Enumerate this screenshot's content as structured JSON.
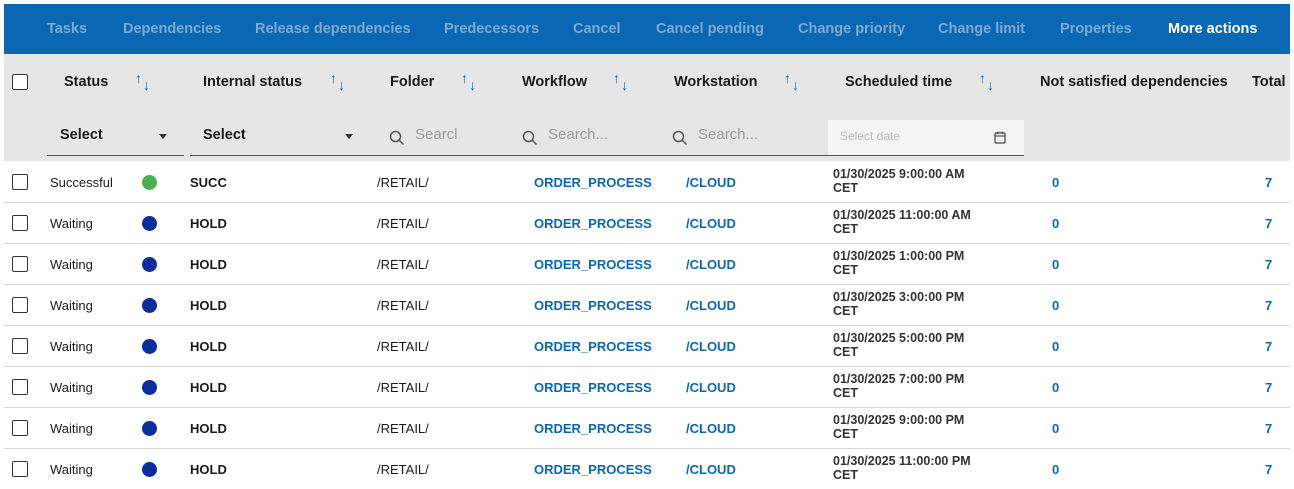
{
  "toolbar": {
    "items": [
      {
        "label": "Tasks",
        "active": false
      },
      {
        "label": "Dependencies",
        "active": false
      },
      {
        "label": "Release dependencies",
        "active": false
      },
      {
        "label": "Predecessors",
        "active": false
      },
      {
        "label": "Cancel",
        "active": false
      },
      {
        "label": "Cancel pending",
        "active": false
      },
      {
        "label": "Change priority",
        "active": false
      },
      {
        "label": "Change limit",
        "active": false
      },
      {
        "label": "Properties",
        "active": false
      },
      {
        "label": "More actions",
        "active": true
      }
    ]
  },
  "columns": {
    "status": "Status",
    "internal_status": "Internal status",
    "folder": "Folder",
    "workflow": "Workflow",
    "workstation": "Workstation",
    "scheduled_time": "Scheduled time",
    "not_satisfied": "Not satisfied dependencies",
    "total": "Total"
  },
  "filters": {
    "status_select": "Select",
    "internal_status_select": "Select",
    "folder_search": "Searcl",
    "workflow_search": "Search...",
    "workstation_search": "Search...",
    "date_placeholder": "Select date"
  },
  "colors": {
    "toolbar_bg": "#0a67b4",
    "success_dot": "#4caf50",
    "waiting_dot": "#0b2f9a",
    "link": "#0a67b4"
  },
  "rows": [
    {
      "status": "Successful",
      "dot": "success",
      "internal": "SUCC",
      "folder": "/RETAIL/",
      "workflow": "ORDER_PROCESS",
      "workstation": "/CLOUD",
      "time": "01/30/2025 9:00:00 AM CET",
      "not_satisfied": "0",
      "total": "7"
    },
    {
      "status": "Waiting",
      "dot": "waiting",
      "internal": "HOLD",
      "folder": "/RETAIL/",
      "workflow": "ORDER_PROCESS",
      "workstation": "/CLOUD",
      "time": "01/30/2025 11:00:00 AM CET",
      "not_satisfied": "0",
      "total": "7"
    },
    {
      "status": "Waiting",
      "dot": "waiting",
      "internal": "HOLD",
      "folder": "/RETAIL/",
      "workflow": "ORDER_PROCESS",
      "workstation": "/CLOUD",
      "time": "01/30/2025 1:00:00 PM CET",
      "not_satisfied": "0",
      "total": "7"
    },
    {
      "status": "Waiting",
      "dot": "waiting",
      "internal": "HOLD",
      "folder": "/RETAIL/",
      "workflow": "ORDER_PROCESS",
      "workstation": "/CLOUD",
      "time": "01/30/2025 3:00:00 PM CET",
      "not_satisfied": "0",
      "total": "7"
    },
    {
      "status": "Waiting",
      "dot": "waiting",
      "internal": "HOLD",
      "folder": "/RETAIL/",
      "workflow": "ORDER_PROCESS",
      "workstation": "/CLOUD",
      "time": "01/30/2025 5:00:00 PM CET",
      "not_satisfied": "0",
      "total": "7"
    },
    {
      "status": "Waiting",
      "dot": "waiting",
      "internal": "HOLD",
      "folder": "/RETAIL/",
      "workflow": "ORDER_PROCESS",
      "workstation": "/CLOUD",
      "time": "01/30/2025 7:00:00 PM CET",
      "not_satisfied": "0",
      "total": "7"
    },
    {
      "status": "Waiting",
      "dot": "waiting",
      "internal": "HOLD",
      "folder": "/RETAIL/",
      "workflow": "ORDER_PROCESS",
      "workstation": "/CLOUD",
      "time": "01/30/2025 9:00:00 PM CET",
      "not_satisfied": "0",
      "total": "7"
    },
    {
      "status": "Waiting",
      "dot": "waiting",
      "internal": "HOLD",
      "folder": "/RETAIL/",
      "workflow": "ORDER_PROCESS",
      "workstation": "/CLOUD",
      "time": "01/30/2025 11:00:00 PM CET",
      "not_satisfied": "0",
      "total": "7"
    }
  ]
}
